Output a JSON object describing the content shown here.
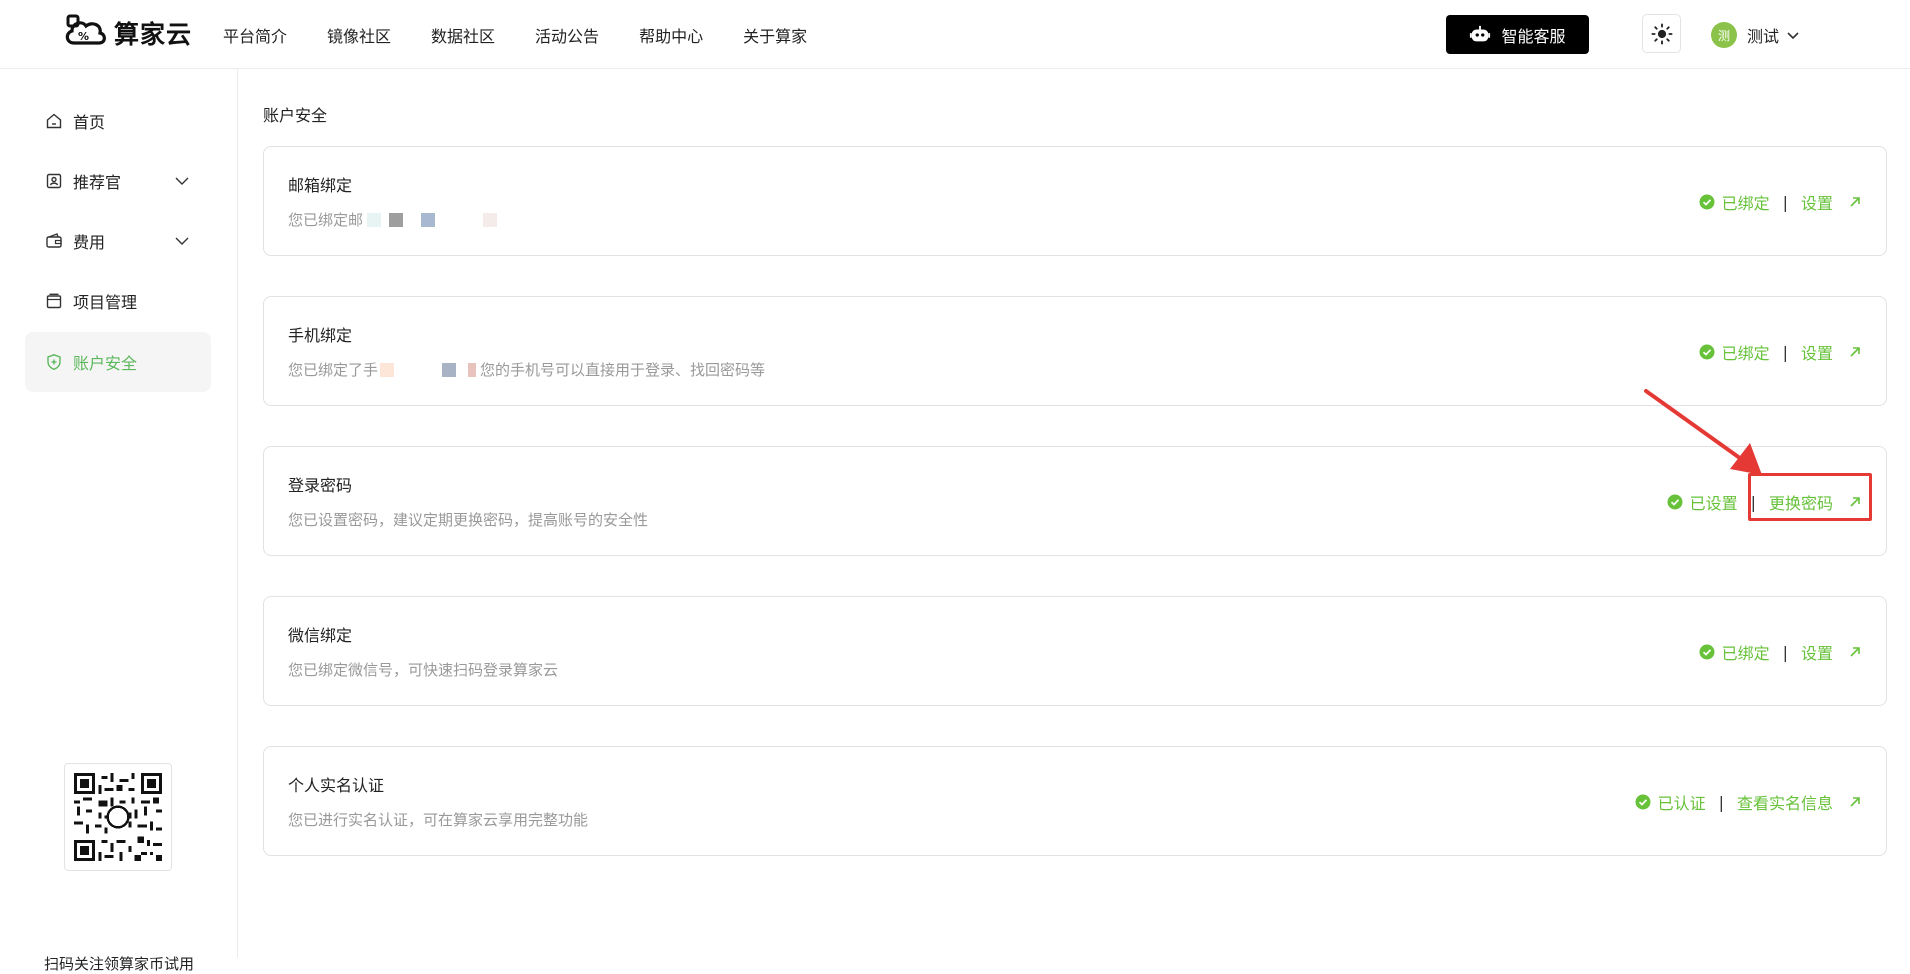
{
  "header": {
    "logo_text": "算家云",
    "nav": [
      "平台简介",
      "镜像社区",
      "数据社区",
      "活动公告",
      "帮助中心",
      "关于算家"
    ],
    "service_button": "智能客服",
    "user": {
      "avatar_text": "测",
      "name": "测试"
    }
  },
  "sidebar": {
    "items": [
      {
        "label": "首页",
        "icon": "home-icon"
      },
      {
        "label": "推荐官",
        "icon": "referral-icon",
        "expandable": true
      },
      {
        "label": "费用",
        "icon": "wallet-icon",
        "expandable": true
      },
      {
        "label": "项目管理",
        "icon": "folder-icon"
      },
      {
        "label": "账户安全",
        "icon": "shield-icon",
        "active": true
      }
    ],
    "qr_caption": "扫码关注领算家币试用"
  },
  "main": {
    "title": "账户安全",
    "cards": [
      {
        "title": "邮箱绑定",
        "desc_prefix": "您已绑定邮",
        "desc_suffix": "",
        "status": "已绑定",
        "action": "设置"
      },
      {
        "title": "手机绑定",
        "desc_prefix": "您已绑定了手",
        "desc_suffix": "您的手机号可以直接用于登录、找回密码等",
        "status": "已绑定",
        "action": "设置"
      },
      {
        "title": "登录密码",
        "desc_prefix": "您已设置密码，建议定期更换密码，提高账号的安全性",
        "desc_suffix": "",
        "status": "已设置",
        "action": "更换密码"
      },
      {
        "title": "微信绑定",
        "desc_prefix": "您已绑定微信号，可快速扫码登录算家云",
        "desc_suffix": "",
        "status": "已绑定",
        "action": "设置"
      },
      {
        "title": "个人实名认证",
        "desc_prefix": "您已进行实名认证，可在算家云享用完整功能",
        "desc_suffix": "",
        "status": "已认证",
        "action": "查看实名信息"
      }
    ]
  },
  "colors": {
    "accent": "#67c23a",
    "highlight": "#e53935"
  }
}
